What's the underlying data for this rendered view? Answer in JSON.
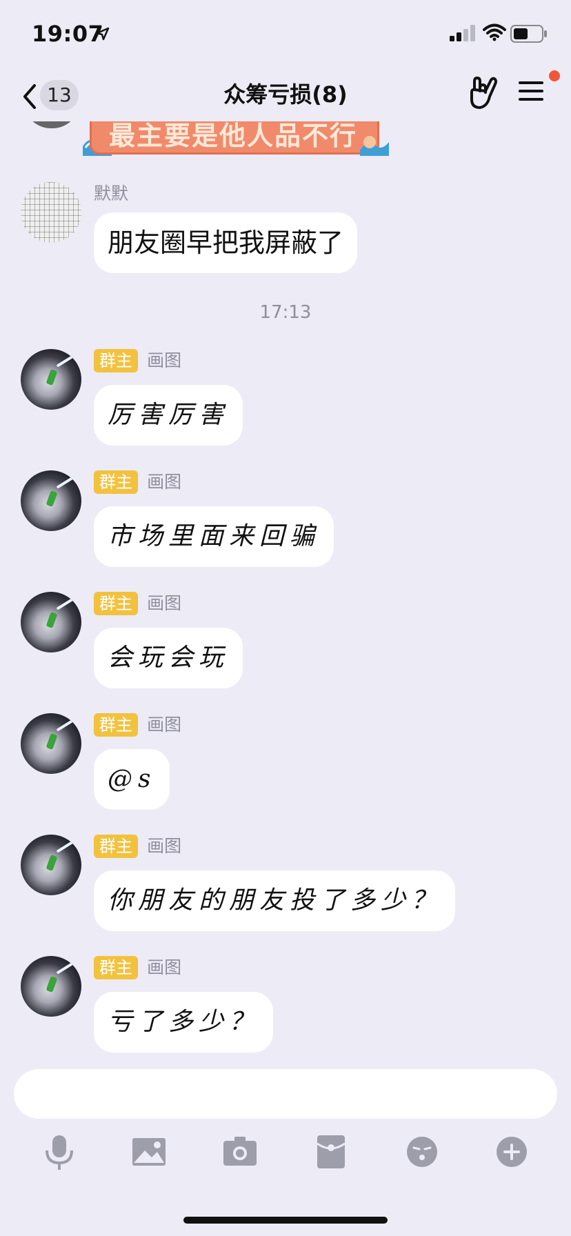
{
  "status_bar": {
    "time": "19:07"
  },
  "nav": {
    "back_count": "13",
    "title": "众筹亏损(8)"
  },
  "sticker": {
    "text": "最主要是他人品不行"
  },
  "messages": [
    {
      "sender": "默默",
      "text": "朋友圈早把我屏蔽了"
    },
    {
      "time": "17:13"
    },
    {
      "badge": "群主",
      "sender": "画图",
      "text": "厉害厉害"
    },
    {
      "badge": "群主",
      "sender": "画图",
      "text": "市场里面来回骗"
    },
    {
      "badge": "群主",
      "sender": "画图",
      "text": "会玩会玩"
    },
    {
      "badge": "群主",
      "sender": "画图",
      "text": "@s"
    },
    {
      "badge": "群主",
      "sender": "画图",
      "text": "你朋友的朋友投了多少？"
    },
    {
      "badge": "群主",
      "sender": "画图",
      "text": "亏了多少？"
    }
  ],
  "toolbar": {
    "icons": [
      "microphone-icon",
      "image-icon",
      "camera-icon",
      "red-packet-icon",
      "emoji-icon",
      "plus-icon"
    ]
  },
  "colors": {
    "background": "#ecebf6",
    "owner_badge": "#f2c23f",
    "notification_dot": "#f0563a"
  }
}
